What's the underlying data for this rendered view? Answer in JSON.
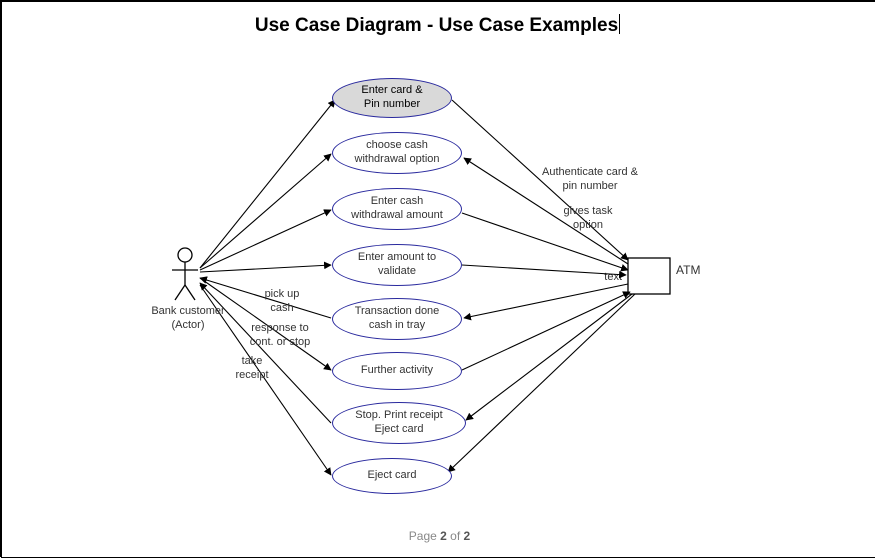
{
  "title": "Use Case Diagram - Use Case Examples",
  "actor": {
    "label": "Bank customer\n(Actor)"
  },
  "system": {
    "label": "ATM",
    "port_text": "text"
  },
  "use_cases": [
    {
      "id": "uc1",
      "label": "Enter card &\nPin number",
      "filled": true
    },
    {
      "id": "uc2",
      "label": "choose cash\nwithdrawal option",
      "filled": false
    },
    {
      "id": "uc3",
      "label": "Enter cash\nwithdrawal amount",
      "filled": false
    },
    {
      "id": "uc4",
      "label": "Enter amount to\nvalidate",
      "filled": false
    },
    {
      "id": "uc5",
      "label": "Transaction done\ncash in tray",
      "filled": false
    },
    {
      "id": "uc6",
      "label": "Further activity",
      "filled": false
    },
    {
      "id": "uc7",
      "label": "Stop. Print receipt\nEject card",
      "filled": false
    },
    {
      "id": "uc8",
      "label": "Eject card",
      "filled": false
    }
  ],
  "edge_labels": {
    "authenticate": "Authenticate card &\npin number",
    "gives_task": "gives task\noption",
    "pick_up_cash": "pick up\ncash",
    "response": "response to\ncont. or stop",
    "take_receipt": "take\nreceipt"
  },
  "footer": {
    "page_word": "Page",
    "current": "2",
    "of_word": "of",
    "total": "2"
  }
}
